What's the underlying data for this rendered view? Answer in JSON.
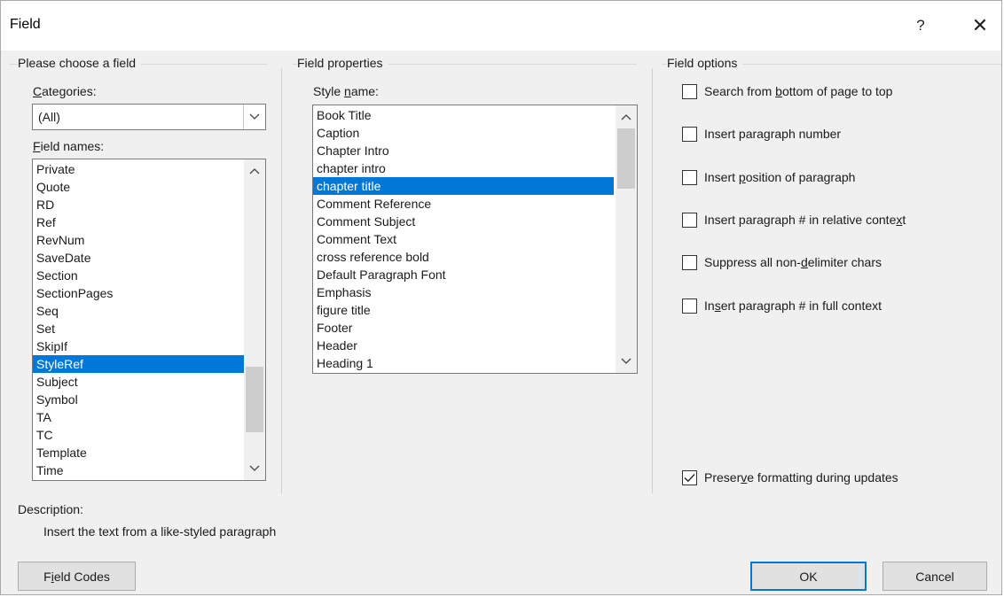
{
  "window": {
    "title": "Field",
    "help_symbol": "?",
    "close_symbol": "✕"
  },
  "left": {
    "group_title": "Please choose a field",
    "categories_label_u": "C",
    "categories_label_rest": "ategories:",
    "categories_value": "(All)",
    "field_names_label_u": "F",
    "field_names_label_rest": "ield names:",
    "field_names": [
      "Private",
      "Quote",
      "RD",
      "Ref",
      "RevNum",
      "SaveDate",
      "Section",
      "SectionPages",
      "Seq",
      "Set",
      "SkipIf",
      "StyleRef",
      "Subject",
      "Symbol",
      "TA",
      "TC",
      "Template",
      "Time"
    ],
    "selected_index": 11
  },
  "middle": {
    "group_title": "Field properties",
    "style_label_pre": "Style ",
    "style_label_u": "n",
    "style_label_post": "ame:",
    "styles": [
      "Book Title",
      "Caption",
      "Chapter Intro",
      "chapter intro",
      "chapter title",
      "Comment Reference",
      "Comment Subject",
      "Comment Text",
      "cross reference bold",
      "Default Paragraph Font",
      "Emphasis",
      "figure title",
      "Footer",
      "Header",
      "Heading 1"
    ],
    "selected_index": 4
  },
  "right": {
    "group_title": "Field options",
    "options": [
      {
        "pre": "Search from ",
        "u": "b",
        "post": "ottom of page to top",
        "checked": false
      },
      {
        "pre": "Insert paragraph number",
        "u": "",
        "post": "",
        "checked": false
      },
      {
        "pre": "Insert ",
        "u": "p",
        "post": "osition of paragraph",
        "checked": false
      },
      {
        "pre": "Insert paragraph # in relative conte",
        "u": "x",
        "post": "t",
        "checked": false
      },
      {
        "pre": "Suppress all non-",
        "u": "d",
        "post": "elimiter chars",
        "checked": false
      },
      {
        "pre": "In",
        "u": "s",
        "post": "ert paragraph # in full context",
        "checked": false
      }
    ],
    "preserve": {
      "pre": "Preser",
      "u": "v",
      "post": "e formatting during updates",
      "checked": true
    }
  },
  "description": {
    "label": "Description:",
    "text": "Insert the text from a like-styled paragraph"
  },
  "buttons": {
    "field_codes_pre": "F",
    "field_codes_u": "i",
    "field_codes_post": "eld Codes",
    "ok": "OK",
    "cancel": "Cancel"
  }
}
